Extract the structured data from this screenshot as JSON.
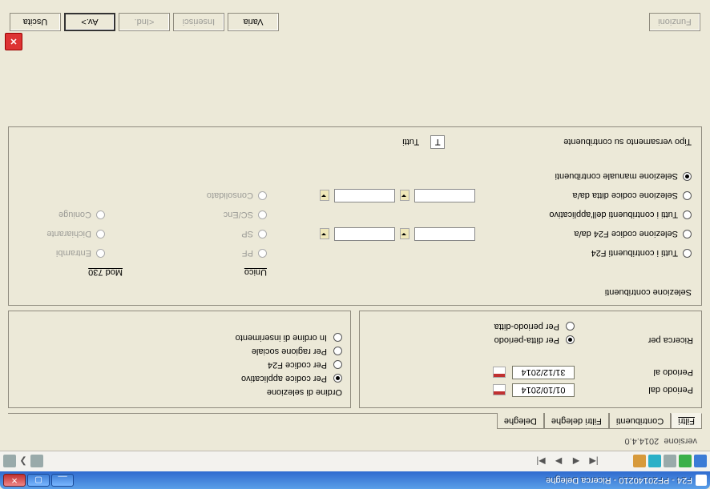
{
  "window": {
    "title": "F24  - PF20140210 - Ricerca Deleghe",
    "min": "__",
    "max": "▢",
    "close": "✕"
  },
  "toolbar": {
    "nav_first": "|◀",
    "nav_prev": "◀",
    "nav_next": "▶",
    "nav_last": "▶|"
  },
  "version_label": "versione",
  "version_value": "2014.4.0",
  "tabs": {
    "filtri": "Filtri",
    "contribuenti": "Contribuenti",
    "filtri_deleghe": "Filtri deleghe",
    "deleghe": "Deleghe"
  },
  "left": {
    "periodo_dal": "Periodo dal",
    "periodo_al": "Periodo al",
    "data_dal": "01/10/2014",
    "data_al": "31/12/2014",
    "ricerca_per": "Ricerca per",
    "per_ditta_periodo": "Per ditta-periodo",
    "per_periodo_ditta": "Per periodo-ditta"
  },
  "right": {
    "ordine_title": "Ordine di selezione",
    "per_codice_applicativo": "Per codice applicativo",
    "per_codice_f24": "Per codice F24",
    "per_ragione_sociale": "Per ragione sociale",
    "in_ordine_inserimento": "In ordine di inserimento"
  },
  "sel": {
    "title": "Selezione contribuenti",
    "tutti_f24": "Tutti i contribuenti F24",
    "sel_codice_f24": "Selezione codice F24 da/a",
    "tutti_applicativo": "Tutti i contribuenti dell'applicativo",
    "sel_codice_ditta": "Selezione codice ditta da/a",
    "sel_manuale": "Selezione manuale contribuenti",
    "col_unico": "Unico",
    "col_mod730": "Mod 730",
    "pf": "PF",
    "sp": "SP",
    "scenc": "SC/Enc",
    "consolidato": "Consolidato",
    "entrambi": "Entrambi",
    "dichiarante": "Dichiarante",
    "coniuge": "Coniuge"
  },
  "tipo": {
    "label": "Tipo versamento su contribuente",
    "value": "T",
    "desc": "Tutti"
  },
  "buttons": {
    "funzioni": "Funzioni",
    "varia": "Varia",
    "inserisci": "Inserisci",
    "ind": "<Ind.",
    "av": "Av.>",
    "uscita": "Uscita"
  }
}
